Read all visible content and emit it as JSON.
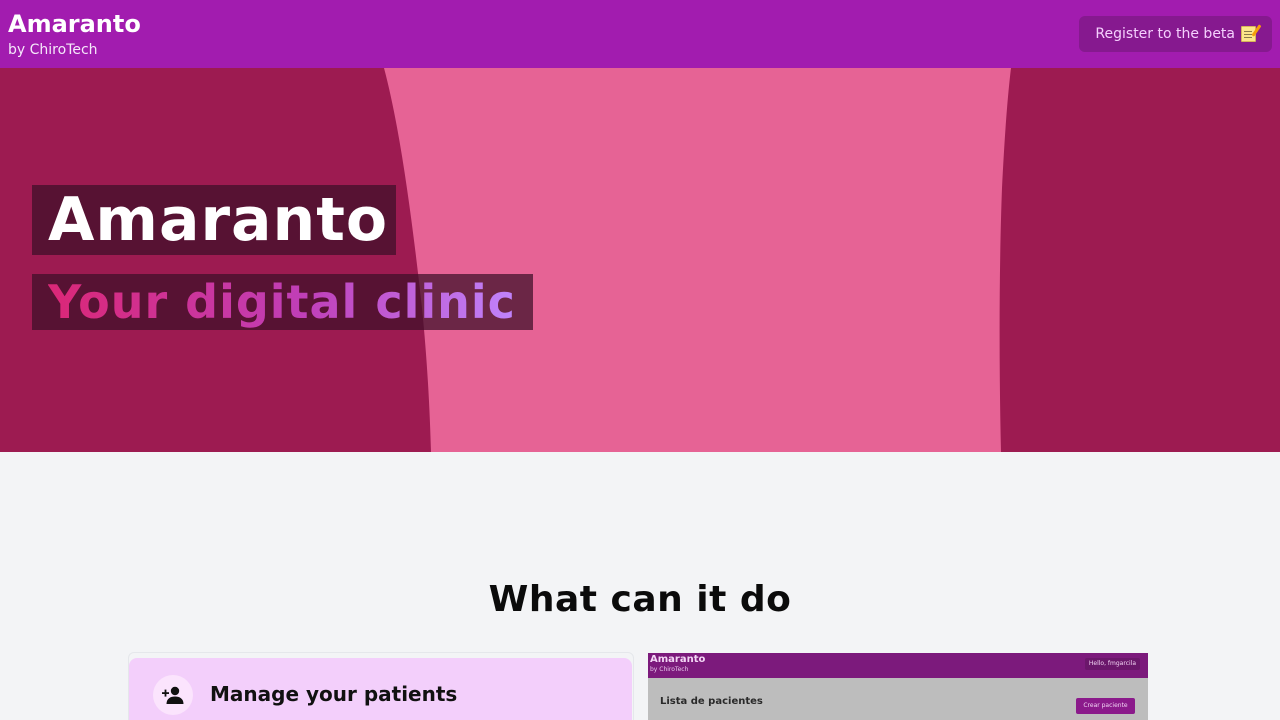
{
  "header": {
    "app_name": "Amaranto",
    "byline": "by ChiroTech",
    "register_label": "Register to the beta",
    "register_icon": "memo-icon"
  },
  "hero": {
    "title": "Amaranto",
    "subtitle": "Your digital clinic",
    "colors": {
      "background": "#9d1b51",
      "stripe": "#e66395"
    }
  },
  "features": {
    "heading": "What can it do",
    "items": [
      {
        "title": "Manage your patients",
        "icon": "add-person-icon"
      }
    ]
  },
  "preview": {
    "app_name": "Amaranto",
    "byline": "by ChiroTech",
    "greeting": "Hello, fmgarcila",
    "list_title": "Lista de pacientes",
    "create_label": "Crear paciente"
  },
  "colors": {
    "topbar": "#a21caf",
    "button": "#86198f",
    "page_bg": "#f3f4f6",
    "feature_card": "#f3cffb"
  }
}
